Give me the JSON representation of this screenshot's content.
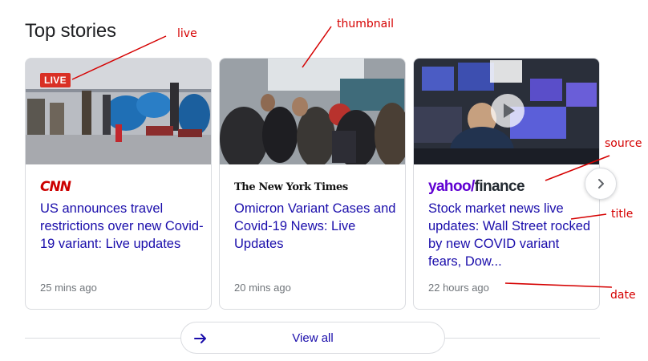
{
  "section": {
    "title": "Top stories"
  },
  "stories": [
    {
      "live_label": "LIVE",
      "source": "CNN",
      "title": "US announces travel restrictions over new Covid-19 variant: Live updates",
      "date": "25 mins ago"
    },
    {
      "source": "The New York Times",
      "title": "Omicron Variant Cases and Covid-19 News: Live Updates",
      "date": "20 mins ago"
    },
    {
      "source_part1": "yahoo",
      "source_part2": "/",
      "source_part3": "finance",
      "title": "Stock market news live updates: Wall Street rocked by new COVID variant fears, Dow...",
      "date": "22 hours ago"
    }
  ],
  "view_all": {
    "label": "View all"
  },
  "annotations": {
    "live": "live",
    "thumbnail": "thumbnail",
    "source": "source",
    "title": "title",
    "date": "date"
  },
  "colors": {
    "link": "#1a0dab",
    "live_badge": "#d93025",
    "annotation": "#d50000",
    "muted_text": "#70757a"
  },
  "icons": [
    "chevron-right-icon",
    "arrow-right-icon",
    "play-icon"
  ]
}
